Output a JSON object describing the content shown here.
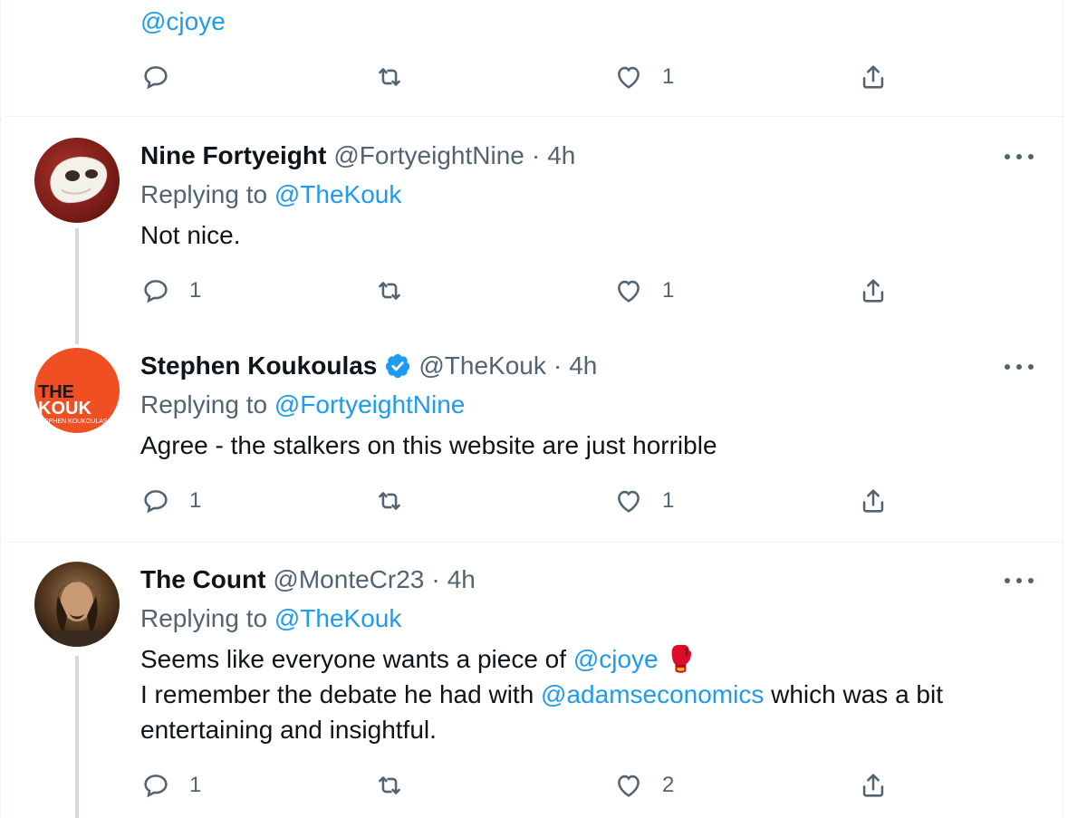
{
  "fragment": {
    "handle": "@cjoye",
    "likes": "1"
  },
  "tweets": [
    {
      "name": "Nine Fortyeight",
      "handle": "@FortyeightNine",
      "dot": "·",
      "time": "4h",
      "replying_label": "Replying to",
      "replying_to": "@TheKouk",
      "text": "Not nice.",
      "replies": "1",
      "likes": "1",
      "avatar": "phantom-mask-icon"
    },
    {
      "name": "Stephen Koukoulas",
      "handle": "@TheKouk",
      "dot": "·",
      "time": "4h",
      "verified": true,
      "replying_label": "Replying to",
      "replying_to": "@FortyeightNine",
      "text": "Agree - the stalkers on this website are just horrible",
      "replies": "1",
      "likes": "1",
      "avatar_text_1": "THE",
      "avatar_text_2": "KOUK",
      "avatar_text_3": "STEPHEN KOUKOULAS"
    },
    {
      "name": "The Count",
      "handle": "@MonteCr23",
      "dot": "·",
      "time": "4h",
      "replying_label": "Replying to",
      "replying_to": "@TheKouk",
      "text_line1_pre": "Seems like everyone wants a piece of ",
      "text_line1_mention": "@cjoye",
      "text_line1_emoji": "🥊",
      "text_line2_pre": "I remember the debate he had with ",
      "text_line2_mention": "@adamseconomics",
      "text_line2_post": " which was a bit",
      "text_line3": "entertaining and insightful.",
      "replies": "1",
      "likes": "2",
      "avatar": "portrait-photo"
    }
  ],
  "colors": {
    "accent": "#1d9bf0",
    "muted": "#536471",
    "verified": "#1d9bf0",
    "brand_orange": "#f04e23"
  }
}
